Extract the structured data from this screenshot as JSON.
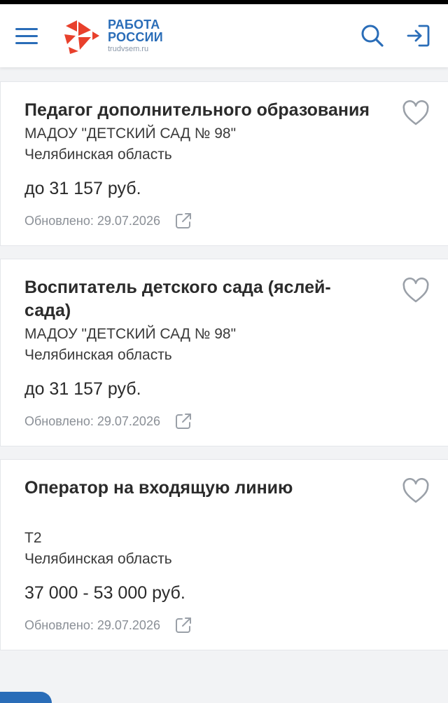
{
  "header": {
    "logo_line1": "РАБОТА",
    "logo_line2": "РОССИИ",
    "logo_domain": "trudvsem.ru",
    "menu_icon": "hamburger-menu-icon",
    "search_icon": "search-icon",
    "login_icon": "login-icon"
  },
  "colors": {
    "brand_blue": "#2a6db8",
    "logo_red": "#e8402c",
    "text": "#2b2b2b",
    "muted": "#8a8f96"
  },
  "vacancies": [
    {
      "title": "Педагог дополнительного образования",
      "employer": "МАДОУ \"ДЕТСКИЙ САД № 98\"",
      "region": "Челябинская область",
      "salary": "до 31 157 руб.",
      "updated": "Обновлено: 29.07.2026"
    },
    {
      "title": "Воспитатель детского сада (яслей-сада)",
      "employer": "МАДОУ \"ДЕТСКИЙ САД № 98\"",
      "region": "Челябинская область",
      "salary": "до 31 157 руб.",
      "updated": "Обновлено: 29.07.2026"
    },
    {
      "title": "Оператор на входящую линию",
      "employer": "T2",
      "region": "Челябинская область",
      "salary": "37 000 - 53 000 руб.",
      "updated": "Обновлено: 29.07.2026"
    }
  ]
}
